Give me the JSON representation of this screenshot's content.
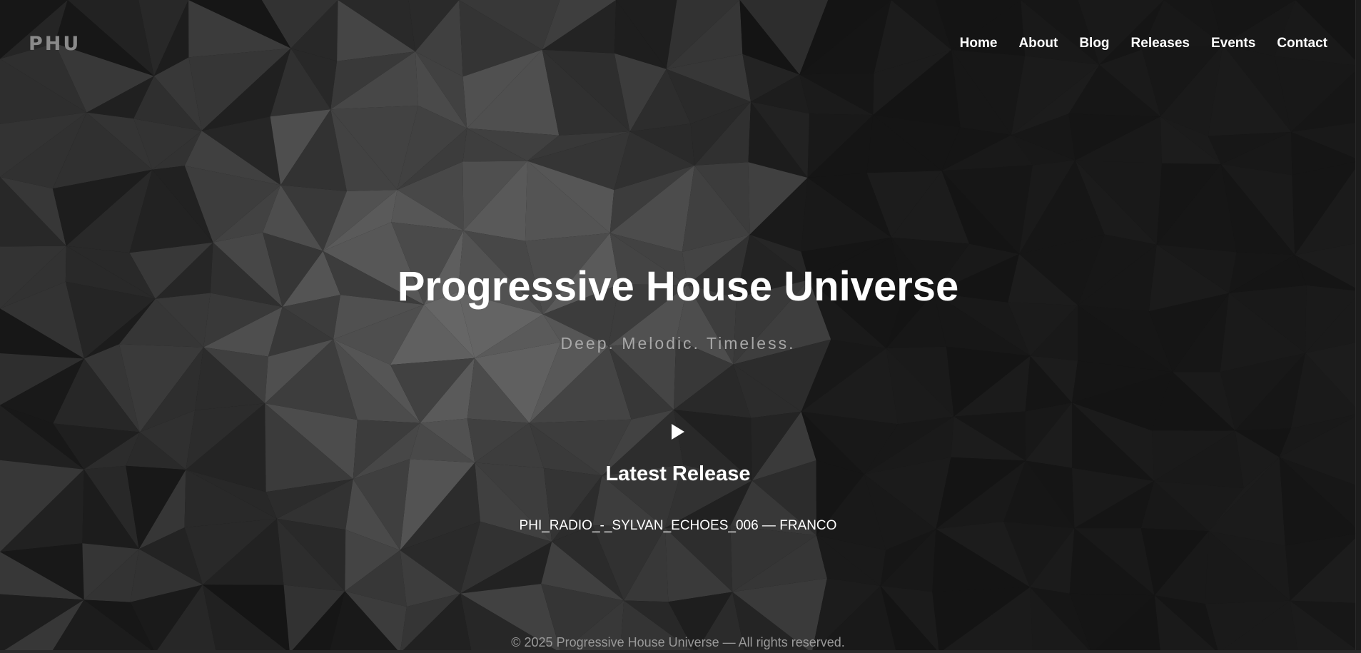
{
  "header": {
    "logo": "PHU",
    "nav": [
      "Home",
      "About",
      "Blog",
      "Releases",
      "Events",
      "Contact"
    ]
  },
  "hero": {
    "title": "Progressive House Universe",
    "subtitle": "Deep. Melodic. Timeless.",
    "play_icon": "play-icon",
    "latest_heading": "Latest Release",
    "track": "PHI_RADIO_-_SYLVAN_ECHOES_006 — FRANCO"
  },
  "footer": {
    "text": "© 2025 Progressive House Universe — All rights reserved."
  },
  "colors": {
    "background": "#161616",
    "text": "#ffffff",
    "muted": "#a8a8a8"
  }
}
